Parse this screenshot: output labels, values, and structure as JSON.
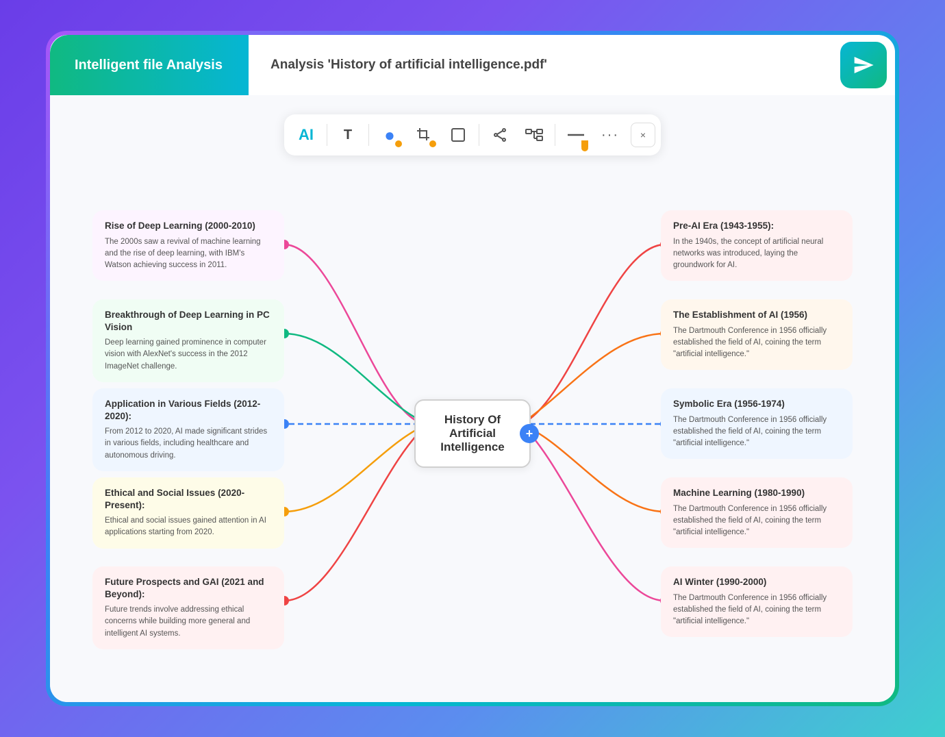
{
  "app": {
    "brand": "Intelligent file Analysis",
    "file_label": "Analysis ",
    "file_name": "'History of artificial intelligence.pdf'",
    "send_icon": "➤"
  },
  "toolbar": {
    "items": [
      {
        "id": "ai",
        "label": "AI",
        "type": "text-ai"
      },
      {
        "id": "text",
        "label": "T",
        "type": "text"
      },
      {
        "id": "circle",
        "label": "●",
        "type": "shape-circle"
      },
      {
        "id": "crop",
        "label": "⬚+",
        "type": "shape-crop"
      },
      {
        "id": "rect",
        "label": "□",
        "type": "shape-rect"
      },
      {
        "id": "share",
        "label": "⇌",
        "type": "share"
      },
      {
        "id": "connect",
        "label": "⇆",
        "type": "connect"
      },
      {
        "id": "line",
        "label": "—",
        "type": "line"
      },
      {
        "id": "more",
        "label": "···",
        "type": "more"
      }
    ],
    "close": "×"
  },
  "mindmap": {
    "center": {
      "line1": "History Of Artificial",
      "line2": "Intelligence",
      "plus": "+"
    },
    "left_nodes": [
      {
        "title": "Rise of Deep Learning (2000-2010)",
        "body": "The 2000s saw a revival of machine learning and the rise of deep learning, with IBM's Watson achieving success in 2011.",
        "dot_color": "#ec4899"
      },
      {
        "title": "Breakthrough of Deep Learning in PC Vision",
        "body": "Deep learning gained prominence in computer vision with AlexNet's success in the 2012 ImageNet challenge.",
        "dot_color": "#10b981"
      },
      {
        "title": "Application in Various Fields (2012-2020):",
        "body": "From 2012 to 2020, AI made significant strides in various fields, including healthcare and autonomous driving.",
        "dot_color": "#3b82f6"
      },
      {
        "title": "Ethical and Social Issues  (2020-Present):",
        "body": "Ethical and social issues gained attention in AI applications starting from 2020.",
        "dot_color": "#f59e0b"
      },
      {
        "title": "Future Prospects and GAI (2021 and Beyond):",
        "body": "Future trends involve addressing ethical concerns while building more general and intelligent AI systems.",
        "dot_color": "#ef4444"
      }
    ],
    "right_nodes": [
      {
        "title": "Pre-AI Era (1943-1955):",
        "body": "In the 1940s, the concept of artificial neural networks was introduced, laying the groundwork for AI.",
        "dot_color": "#ef4444"
      },
      {
        "title": "The Establishment of AI (1956)",
        "body": "The Dartmouth Conference in 1956 officially established the field of AI, coining the term \"artificial intelligence.\"",
        "dot_color": "#f97316"
      },
      {
        "title": "Symbolic Era (1956-1974)",
        "body": "The Dartmouth Conference in 1956 officially established the field of AI, coining the term \"artificial intelligence.\"",
        "dot_color": "#3b82f6"
      },
      {
        "title": "Machine Learning (1980-1990)",
        "body": "The Dartmouth Conference in 1956 officially established the field of AI, coining the term \"artificial intelligence.\"",
        "dot_color": "#f97316"
      },
      {
        "title": "AI Winter (1990-2000)",
        "body": "The Dartmouth Conference in 1956 officially established the field of AI, coining the term \"artificial intelligence.\"",
        "dot_color": "#ec4899"
      }
    ]
  }
}
